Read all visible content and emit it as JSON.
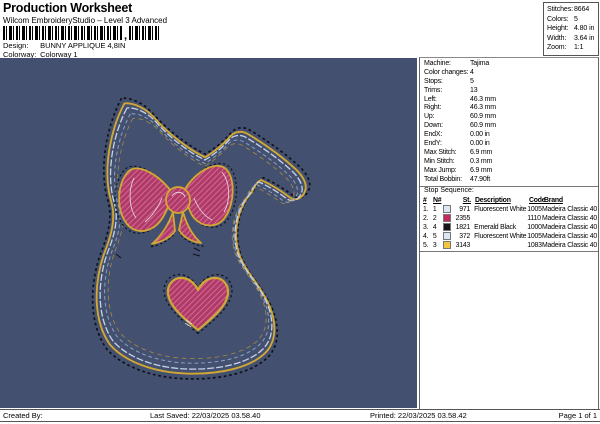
{
  "header": {
    "title": "Production Worksheet",
    "subtitle": "Wilcom EmbroideryStudio – Level 3 Advanced",
    "design_label": "Design:",
    "design_value": "BUNNY APPLIQUE 4,8IN",
    "colorway_label": "Colorway:",
    "colorway_value": "Colorway 1",
    "barcode_separator": ","
  },
  "stats_box": {
    "rows": [
      {
        "label": "Stitches:",
        "value": "8664"
      },
      {
        "label": "Colors:",
        "value": "5"
      },
      {
        "label": "Height:",
        "value": "4.80 in"
      },
      {
        "label": "Width:",
        "value": "3.64 in"
      },
      {
        "label": "Zoom:",
        "value": "1:1"
      }
    ]
  },
  "machine_info": {
    "rows": [
      {
        "label": "Machine:",
        "value": "Tajima"
      },
      {
        "label": "Color changes:",
        "value": "4"
      },
      {
        "label": "Stops:",
        "value": "5"
      },
      {
        "label": "Trims:",
        "value": "13"
      },
      {
        "label": "Left:",
        "value": "46.3 mm"
      },
      {
        "label": "Right:",
        "value": "46.3 mm"
      },
      {
        "label": "Up:",
        "value": "60.9 mm"
      },
      {
        "label": "Down:",
        "value": "60.9 mm"
      },
      {
        "label": "EndX:",
        "value": "0.00 in"
      },
      {
        "label": "EndY:",
        "value": "0.00 in"
      },
      {
        "label": "Max Stitch:",
        "value": "6.9 mm"
      },
      {
        "label": "Min Stitch:",
        "value": "0.3 mm"
      },
      {
        "label": "Max Jump:",
        "value": "6.9 mm"
      },
      {
        "label": "Total Bobbin:",
        "value": "47.90ft"
      }
    ]
  },
  "stop_sequence": {
    "title": "Stop Sequence:",
    "columns": {
      "seq": "#",
      "needle": "N#",
      "stitches": "St.",
      "description": "Description",
      "code": "Code",
      "brand": "Brand"
    },
    "rows": [
      {
        "seq": "1.",
        "needle": "1",
        "swatch_color": "#dbe7f3",
        "stitches": "971",
        "description": "Fluorescent White",
        "code": "1005",
        "brand": "Madeira Classic 40"
      },
      {
        "seq": "2.",
        "needle": "2",
        "swatch_color": "#c22a60",
        "stitches": "2355",
        "description": "",
        "code": "1110",
        "brand": "Madeira Classic 40"
      },
      {
        "seq": "3.",
        "needle": "4",
        "swatch_color": "#15151b",
        "stitches": "1821",
        "description": "Emerald Black",
        "code": "1000",
        "brand": "Madeira Classic 40"
      },
      {
        "seq": "4.",
        "needle": "5",
        "swatch_color": "#dbe7f3",
        "stitches": "372",
        "description": "Fluorescent White",
        "code": "1005",
        "brand": "Madeira Classic 40"
      },
      {
        "seq": "5.",
        "needle": "3",
        "swatch_color": "#f2c440",
        "stitches": "3143",
        "description": "",
        "code": "1083",
        "brand": "Madeira Classic 40"
      }
    ]
  },
  "canvas": {
    "background": "#44506f",
    "design": "bunny applique outline with bow and heart",
    "colors": {
      "outline_light": "#c6d2e9",
      "outline_gold": "#d2a832",
      "outline_black": "#0d1119",
      "applique_pink": "#ad3a68"
    }
  },
  "footer": {
    "created_by": "Created By:",
    "last_saved": "Last Saved: 22/03/2025 03.58.40",
    "printed": "Printed: 22/03/2025 03.58.42",
    "page": "Page 1 of 1"
  }
}
